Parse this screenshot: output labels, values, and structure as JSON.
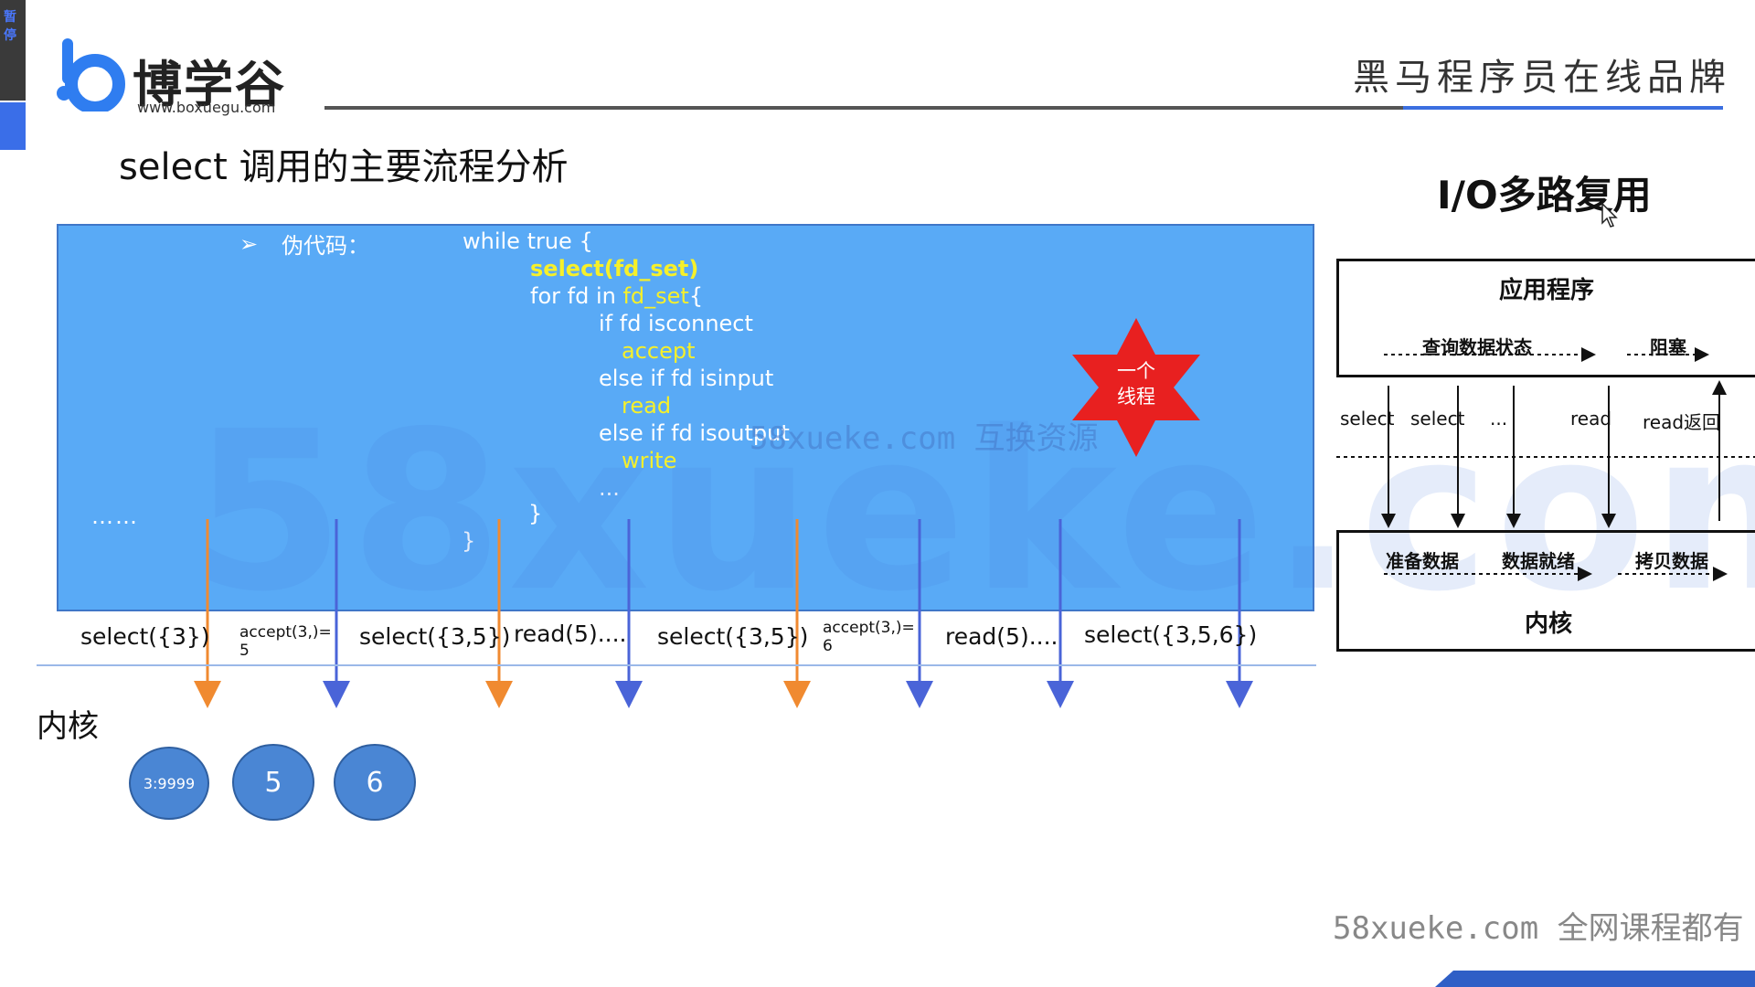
{
  "pause_label": "暂停",
  "logo": {
    "name": "博学谷",
    "url": "www.boxuegu.com"
  },
  "brand_slogan": "黑马程序员在线品牌",
  "slide_title": "select 调用的主要流程分析",
  "pseudocode": {
    "label": "伪代码：",
    "lines": [
      "while true {",
      "select(fd_set)",
      "for fd in ",
      "fd_set",
      "{",
      "if fd isconnect",
      "accept",
      "else if fd isinput",
      "read",
      "else if fd isoutput",
      "write",
      "...",
      "}",
      "}"
    ],
    "dots": "……"
  },
  "star_label": [
    "一个",
    "线程"
  ],
  "watermarks": {
    "big": "58xueke.com",
    "mid": "58xueke.com 互换资源",
    "bottom": "58xueke.com 全网课程都有"
  },
  "timeline_calls": [
    "select({3})",
    "accept(3,)=",
    "5",
    "select({3,5})",
    "read(5)....",
    "select({3,5})",
    "accept(3,)=",
    "6",
    "read(5)....",
    "select({3,5,6})"
  ],
  "kernel_label": "内核",
  "fd_circles": [
    "3:9999",
    "5",
    "6"
  ],
  "io_diagram": {
    "title": "I/O多路复用",
    "app_box": {
      "title": "应用程序",
      "query": "查询数据状态",
      "block": "阻塞"
    },
    "calls": [
      "select",
      "select",
      "...",
      "read",
      "read返回"
    ],
    "kernel_box": {
      "prep": "准备数据",
      "ready": "数据就绪",
      "copy": "拷贝数据",
      "title": "内核"
    }
  },
  "colors": {
    "panel": "#59aaf6",
    "code_highlight": "#f6f02a",
    "arrow_orange": "#f08a30",
    "arrow_blue": "#4a64d8",
    "star": "#e82020"
  }
}
